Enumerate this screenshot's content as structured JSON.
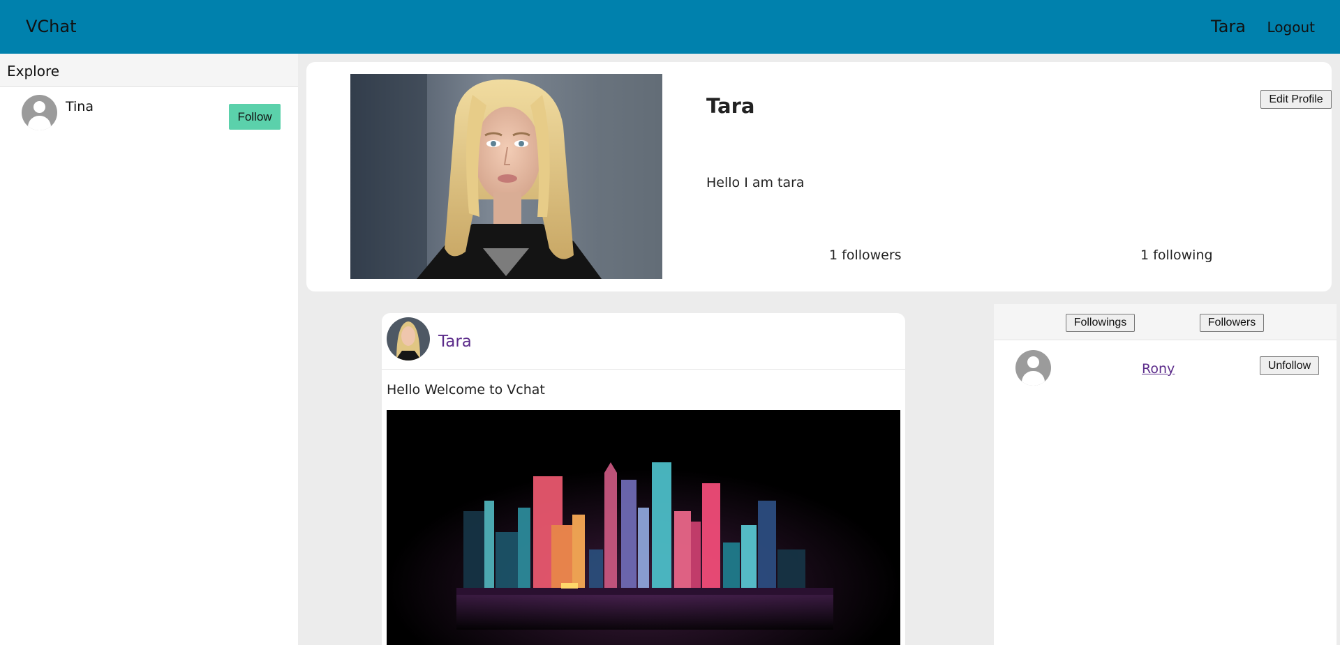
{
  "navbar": {
    "brand": "VChat",
    "user": "Tara",
    "logout": "Logout",
    "color": "#0081ad"
  },
  "sidebar": {
    "title": "Explore",
    "users": [
      {
        "name": "Tina",
        "action": "Follow",
        "action_color": "#5bd1ab"
      }
    ]
  },
  "profile": {
    "name": "Tara",
    "edit_label": "Edit Profile",
    "bio": "Hello I am tara",
    "followers": "1 followers",
    "following": "1 following"
  },
  "post": {
    "author": "Tara",
    "text": "Hello Welcome to Vchat"
  },
  "follow_panel": {
    "tabs": [
      "Followings",
      "Followers"
    ],
    "users": [
      {
        "name": "Rony",
        "action": "Unfollow"
      }
    ]
  }
}
